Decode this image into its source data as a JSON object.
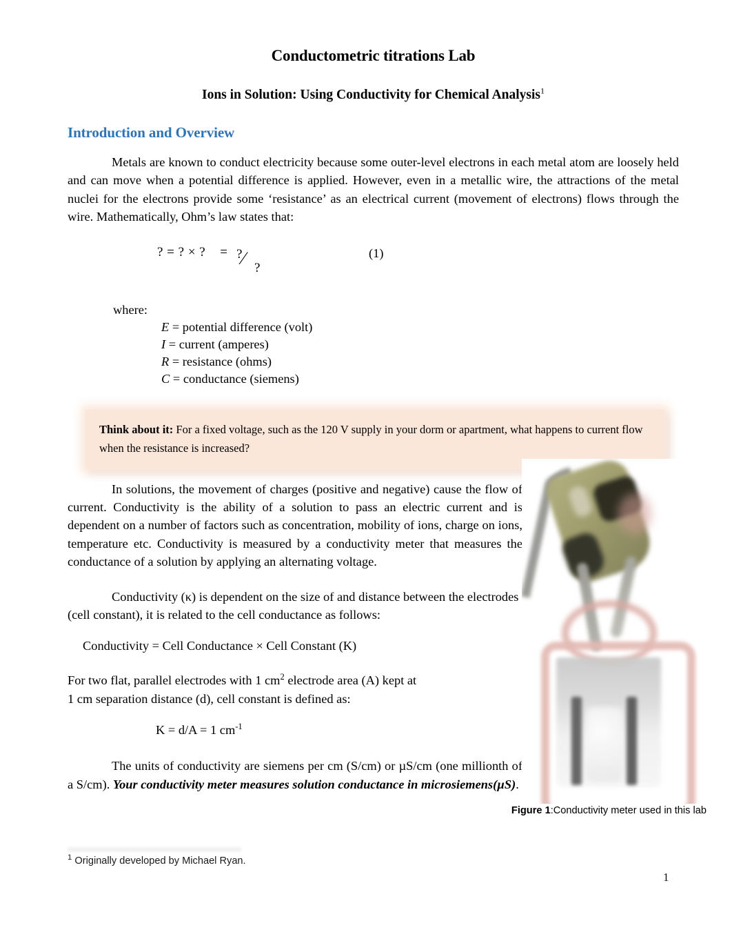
{
  "document": {
    "title": "Conductometric titrations Lab",
    "subtitle": "Ions in Solution: Using Conductivity for Chemical Analysis",
    "subtitle_footnote_marker": "1",
    "section_heading": "Introduction and Overview",
    "page_number": "1"
  },
  "paragraphs": {
    "intro": "Metals are known to conduct electricity because some outer-level electrons in each metal atom are loosely held and can move when a potential difference is applied. However, even in a metallic wire, the attractions of the metal nuclei for the electrons provide some ‘resistance’ as an electrical current (movement of electrons) flows through the wire. Mathematically, Ohm’s law states that:",
    "solutions": "In solutions, the movement of charges (positive and negative) cause the flow of current. Conductivity is the ability of a solution to pass an electric current and is dependent on a number of factors such as concentration, mobility of ions, charge on ions, temperature etc. Conductivity is measured by a conductivity meter that measures the conductance of a solution by applying an alternating voltage.",
    "cell_constant": "Conductivity (κ) is dependent on the size of and distance between the electrodes (cell constant), it is related to the cell conductance as follows:",
    "conductivity_relation": "Conductivity = Cell Conductance × Cell Constant (K)",
    "electrodes_line1_a": "For two flat, parallel electrodes with 1 cm",
    "electrodes_line1_sup": "2",
    "electrodes_line1_b": " electrode area (A) kept at",
    "electrodes_line2": "1 cm separation distance (d), cell constant is defined as:",
    "k_equation_a": "K = d/A = 1 cm",
    "k_equation_sup": "-1",
    "units_plain": "The units of conductivity are siemens per cm (S/cm) or µS/cm (one millionth of a S/cm). ",
    "units_emphasis": "Your conductivity meter measures solution conductance in microsiemens(µS)",
    "units_end": "."
  },
  "equation": {
    "left": "? = ? × ?    =  ",
    "numerator": "?",
    "slash": "⁄",
    "denominator": "?",
    "number": "(1)"
  },
  "where_block": {
    "label": "where:",
    "definitions": [
      {
        "symbol": "E",
        "text": " = potential difference (volt)"
      },
      {
        "symbol": "I",
        "text": " = current (amperes)"
      },
      {
        "symbol": "R",
        "text": " = resistance (ohms)"
      },
      {
        "symbol": "C",
        "text": " = conductance (siemens)"
      }
    ]
  },
  "callout": {
    "label": "Think about it:",
    "text": " For a fixed voltage, such as the 120 V supply in your dorm or apartment, what happens to current flow when the resistance is increased?",
    "background_color": "#fbe7d9"
  },
  "figure": {
    "caption_label": "Figure 1",
    "caption_text": ":Conductivity meter used in this lab",
    "alt": "conductivity-meter-photo"
  },
  "footnote": {
    "marker": "1",
    "text": " Originally developed by Michael Ryan."
  },
  "colors": {
    "heading_blue": "#2e74b5",
    "callout_peach": "#fbe7d9",
    "text_black": "#000000"
  }
}
